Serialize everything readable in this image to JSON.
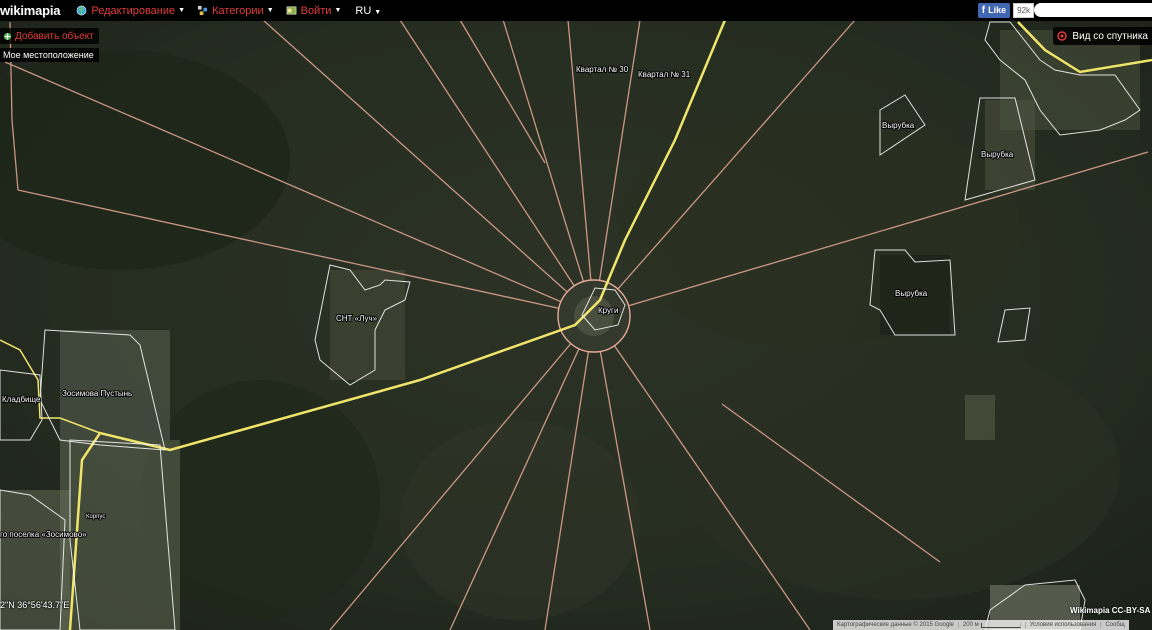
{
  "topbar": {
    "logo": "wikimapia",
    "menu": [
      {
        "label": "Редактирование",
        "icon": "globe-icon"
      },
      {
        "label": "Категории",
        "icon": "category-icon"
      },
      {
        "label": "Войти",
        "icon": "login-icon"
      }
    ],
    "lang": "RU",
    "facebook": {
      "label": "Like",
      "count": "92k"
    },
    "search": {
      "placeholder": "",
      "value": ""
    }
  },
  "controls": {
    "add_object": "Добавить объект",
    "my_location": "Мое местоположение",
    "satellite_view": "Вид со спутника"
  },
  "labels": {
    "kvartal30": "Квартал № 30",
    "kvartal31": "Квартал № 31",
    "vyrubka1": "Вырубка",
    "vyrubka2": "Вырубка",
    "vyrubka3": "Вырубка",
    "snt": "СНТ «Луч»",
    "krugi": "Круги",
    "zosimova": "Зосимова Пустынь",
    "kladbishe": "Кладбище",
    "posyolok": "го поселка «Зосимово»",
    "korpus": "Корпус"
  },
  "coords": "2\"N 36°56'43.7\"E",
  "attribution": {
    "mapdata": "Картографические данные © 2015 Google",
    "scale_label": "200 м",
    "terms": "Условия использования",
    "feedback": "Сообщ"
  },
  "license": "Wikimapia CC-BY-SA",
  "colors": {
    "accent_red": "#e23b3b",
    "road_yellow": "#f0e46a",
    "ray_pink": "#e7a996",
    "outline_white": "#ffffff"
  }
}
